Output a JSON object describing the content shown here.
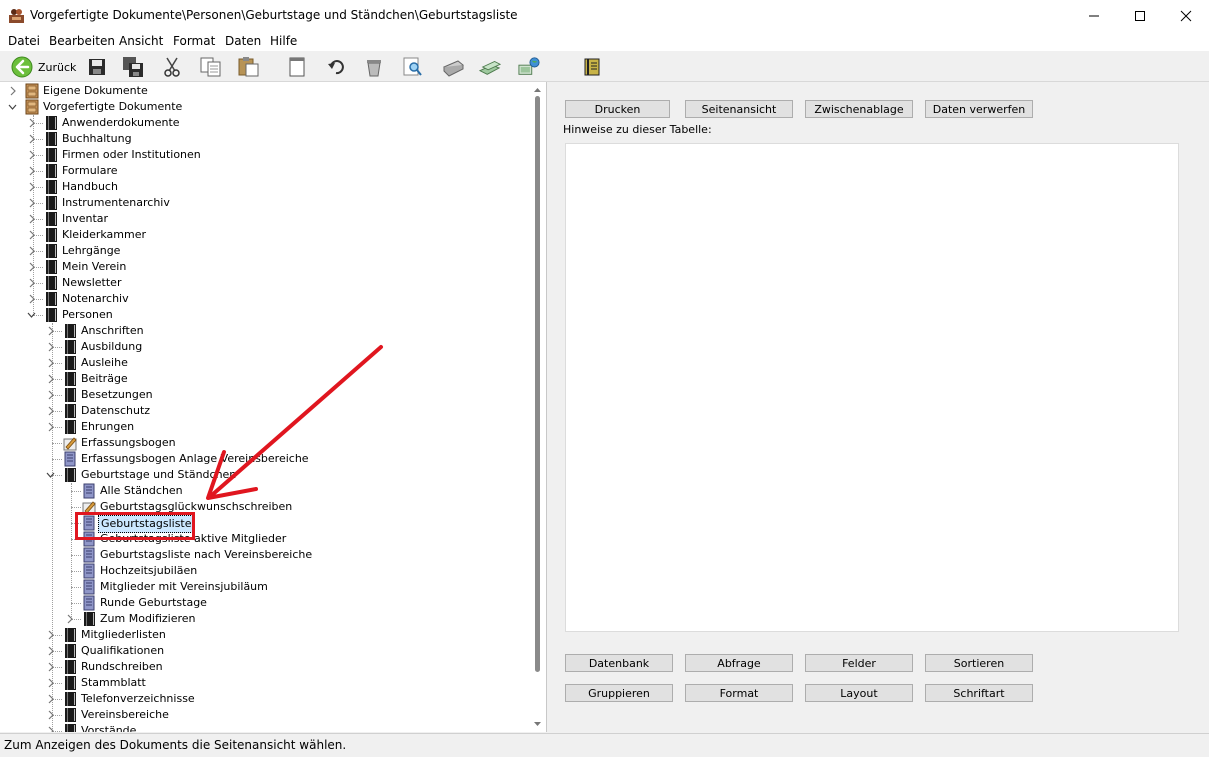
{
  "window": {
    "title": "Vorgefertigte Dokumente\\Personen\\Geburtstage und Ständchen\\Geburtstagsliste"
  },
  "menu": [
    "Datei",
    "Bearbeiten",
    "Ansicht",
    "Format",
    "Daten",
    "Hilfe"
  ],
  "toolbar": {
    "back_label": "Zurück",
    "icons": [
      "back-icon",
      "save-icon",
      "save-all-icon",
      "cut-icon",
      "copy-icon",
      "paste-icon",
      "new-document-icon",
      "undo-icon",
      "delete-icon",
      "search-icon",
      "print-icon",
      "export-icon",
      "network-icon",
      "book-icon"
    ]
  },
  "tree": {
    "items": [
      {
        "label": "Eigene Dokumente",
        "icon": "drawer-icon",
        "level": 0,
        "expander": "collapsed"
      },
      {
        "label": "Vorgefertigte Dokumente",
        "icon": "drawer-icon",
        "level": 0,
        "expander": "expanded"
      },
      {
        "label": "Anwenderdokumente",
        "icon": "book-icon",
        "level": 1,
        "expander": "collapsed"
      },
      {
        "label": "Buchhaltung",
        "icon": "book-icon",
        "level": 1,
        "expander": "collapsed"
      },
      {
        "label": "Firmen oder Institutionen",
        "icon": "book-icon",
        "level": 1,
        "expander": "collapsed"
      },
      {
        "label": "Formulare",
        "icon": "book-icon",
        "level": 1,
        "expander": "collapsed"
      },
      {
        "label": "Handbuch",
        "icon": "book-icon",
        "level": 1,
        "expander": "collapsed"
      },
      {
        "label": "Instrumentenarchiv",
        "icon": "book-icon",
        "level": 1,
        "expander": "collapsed"
      },
      {
        "label": "Inventar",
        "icon": "book-icon",
        "level": 1,
        "expander": "collapsed"
      },
      {
        "label": "Kleiderkammer",
        "icon": "book-icon",
        "level": 1,
        "expander": "collapsed"
      },
      {
        "label": "Lehrgänge",
        "icon": "book-icon",
        "level": 1,
        "expander": "collapsed"
      },
      {
        "label": "Mein Verein",
        "icon": "book-icon",
        "level": 1,
        "expander": "collapsed"
      },
      {
        "label": "Newsletter",
        "icon": "book-icon",
        "level": 1,
        "expander": "collapsed"
      },
      {
        "label": "Notenarchiv",
        "icon": "book-icon",
        "level": 1,
        "expander": "collapsed"
      },
      {
        "label": "Personen",
        "icon": "book-icon",
        "level": 1,
        "expander": "expanded"
      },
      {
        "label": "Anschriften",
        "icon": "book-icon",
        "level": 2,
        "expander": "collapsed"
      },
      {
        "label": "Ausbildung",
        "icon": "book-icon",
        "level": 2,
        "expander": "collapsed"
      },
      {
        "label": "Ausleihe",
        "icon": "book-icon",
        "level": 2,
        "expander": "collapsed"
      },
      {
        "label": "Beiträge",
        "icon": "book-icon",
        "level": 2,
        "expander": "collapsed"
      },
      {
        "label": "Besetzungen",
        "icon": "book-icon",
        "level": 2,
        "expander": "collapsed"
      },
      {
        "label": "Datenschutz",
        "icon": "book-icon",
        "level": 2,
        "expander": "collapsed"
      },
      {
        "label": "Ehrungen",
        "icon": "book-icon",
        "level": 2,
        "expander": "collapsed"
      },
      {
        "label": "Erfassungsbogen",
        "icon": "form-icon",
        "level": 2,
        "expander": "none"
      },
      {
        "label": "Erfassungsbogen Anlage Vereinsbereiche",
        "icon": "document-icon",
        "level": 2,
        "expander": "none"
      },
      {
        "label": "Geburtstage und Ständchen",
        "icon": "book-icon",
        "level": 2,
        "expander": "expanded"
      },
      {
        "label": "Alle Ständchen",
        "icon": "document-icon",
        "level": 3,
        "expander": "none"
      },
      {
        "label": "Geburtstagsglückwunschschreiben",
        "icon": "form-icon",
        "level": 3,
        "expander": "none"
      },
      {
        "label": "Geburtstagsliste",
        "icon": "document-icon",
        "level": 3,
        "expander": "none",
        "selected": true
      },
      {
        "label": "Geburtstagsliste aktive Mitglieder",
        "icon": "document-icon",
        "level": 3,
        "expander": "none"
      },
      {
        "label": "Geburtstagsliste nach Vereinsbereiche",
        "icon": "document-icon",
        "level": 3,
        "expander": "none"
      },
      {
        "label": "Hochzeitsjubiläen",
        "icon": "document-icon",
        "level": 3,
        "expander": "none"
      },
      {
        "label": "Mitglieder mit Vereinsjubiläum",
        "icon": "document-icon",
        "level": 3,
        "expander": "none"
      },
      {
        "label": "Runde Geburtstage",
        "icon": "document-icon",
        "level": 3,
        "expander": "none"
      },
      {
        "label": "Zum Modifizieren",
        "icon": "book-icon",
        "level": 3,
        "expander": "collapsed"
      },
      {
        "label": "Mitgliederlisten",
        "icon": "book-icon",
        "level": 2,
        "expander": "collapsed"
      },
      {
        "label": "Qualifikationen",
        "icon": "book-icon",
        "level": 2,
        "expander": "collapsed"
      },
      {
        "label": "Rundschreiben",
        "icon": "book-icon",
        "level": 2,
        "expander": "collapsed"
      },
      {
        "label": "Stammblatt",
        "icon": "book-icon",
        "level": 2,
        "expander": "collapsed"
      },
      {
        "label": "Telefonverzeichnisse",
        "icon": "book-icon",
        "level": 2,
        "expander": "collapsed"
      },
      {
        "label": "Vereinsbereiche",
        "icon": "book-icon",
        "level": 2,
        "expander": "collapsed"
      },
      {
        "label": "Vorstände",
        "icon": "book-icon",
        "level": 2,
        "expander": "collapsed"
      }
    ]
  },
  "right_panel": {
    "top_buttons": [
      "Drucken",
      "Seitenansicht",
      "Zwischenablage",
      "Daten verwerfen"
    ],
    "hint_label": "Hinweise zu dieser Tabelle:",
    "hint_text": "",
    "bottom_buttons_row1": [
      "Datenbank",
      "Abfrage",
      "Felder",
      "Sortieren"
    ],
    "bottom_buttons_row2": [
      "Gruppieren",
      "Format",
      "Layout",
      "Schriftart"
    ]
  },
  "status": {
    "text": "Zum Anzeigen des Dokuments die Seitenansicht wählen."
  },
  "annotation": {
    "color": "#e0161f"
  }
}
